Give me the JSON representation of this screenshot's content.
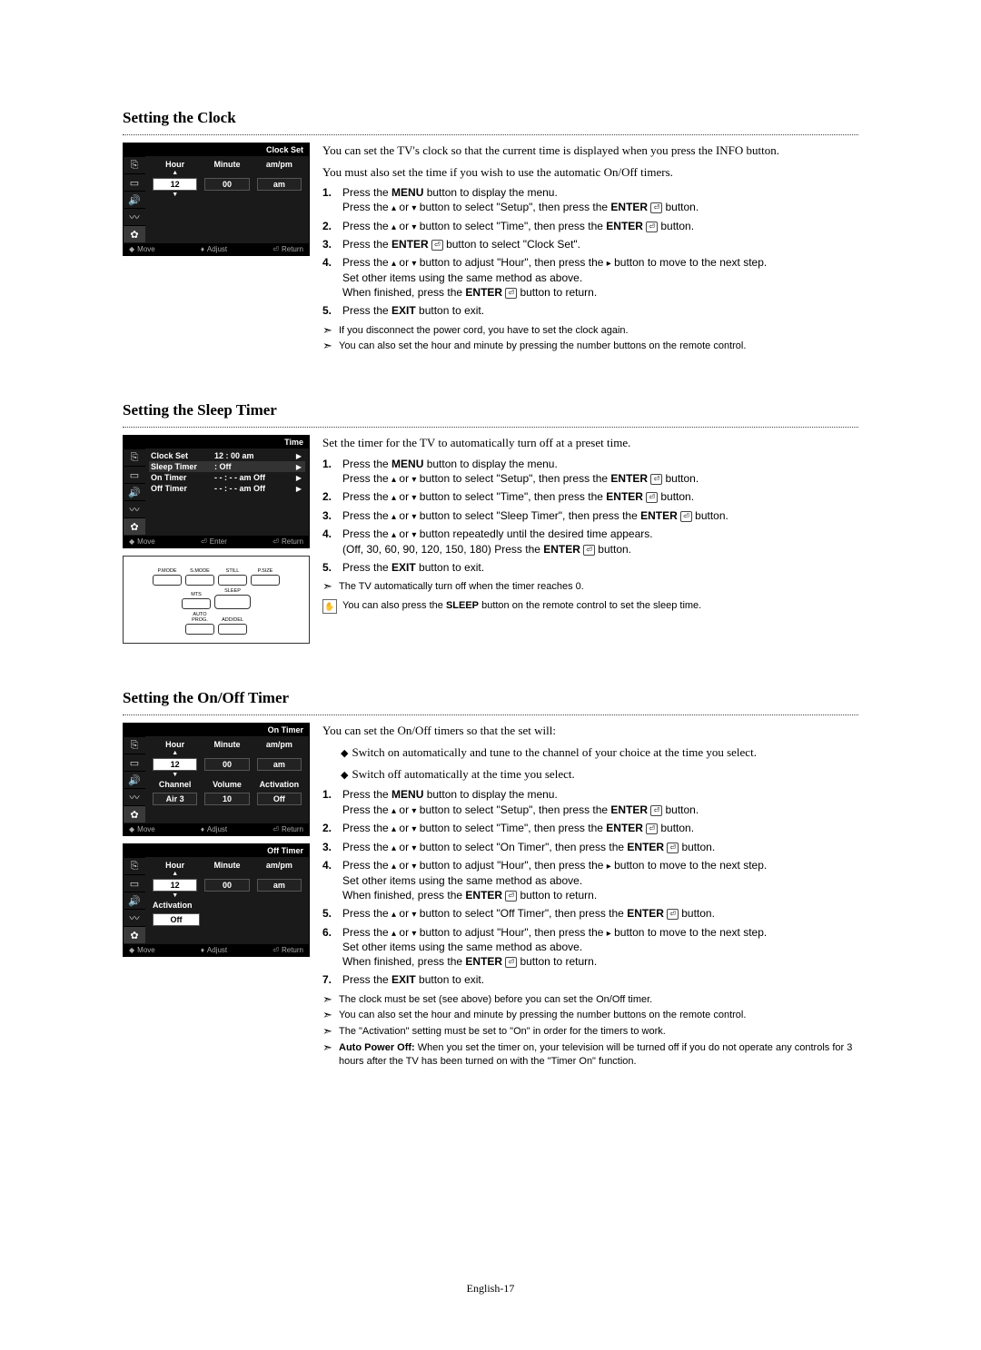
{
  "page_number": "English-17",
  "sections": {
    "clock": {
      "title": "Setting the Clock",
      "intro1": "You can set the TV's clock so that the current time is displayed when you press the INFO button.",
      "intro2": "You must also set the time if you wish to use the automatic On/Off timers.",
      "steps": {
        "s1a": "Press the ",
        "s1b": " button to display the menu.",
        "s1c": "Press the ",
        "s1d": " or ",
        "s1e": " button to select \"Setup\", then press the ",
        "s1f": " button.",
        "s2a": "Press the ",
        "s2b": " or ",
        "s2c": " button to select \"Time\", then press the ",
        "s2d": " button.",
        "s3a": "Press the ",
        "s3b": " button to select \"Clock Set\".",
        "s4a": "Press the ",
        "s4b": " or ",
        "s4c": " button to adjust \"Hour\", then press the ",
        "s4d": " button to move to the next step.",
        "s4e": "Set other items using the same method as above.",
        "s4f": "When finished, press the ",
        "s4g": " button to return.",
        "s5a": "Press the ",
        "s5b": " button to exit."
      },
      "notes": {
        "n1": "If you disconnect the power cord, you have to set the clock again.",
        "n2": "You can also set the hour and minute by pressing the number buttons on the remote control."
      },
      "osd": {
        "title": "Clock  Set",
        "hour_h": "Hour",
        "minute_h": "Minute",
        "ampm_h": "am/pm",
        "hour_v": "12",
        "minute_v": "00",
        "ampm_v": "am",
        "move": "Move",
        "adjust": "Adjust",
        "ret": "Return"
      }
    },
    "sleep": {
      "title": "Setting the Sleep Timer",
      "intro": "Set the timer for the TV to automatically turn off at a preset time.",
      "steps": {
        "s1a": "Press the ",
        "s1b": " button to display the menu.",
        "s1c": "Press the ",
        "s1d": " or ",
        "s1e": " button to select \"Setup\", then press the ",
        "s1f": " button.",
        "s2a": "Press the ",
        "s2b": " or ",
        "s2c": " button to select \"Time\", then press the ",
        "s2d": " button.",
        "s3a": "Press the ",
        "s3b": " or ",
        "s3c": " button to select \"Sleep Timer\", then press the ",
        "s3d": " button.",
        "s4a": "Press the ",
        "s4b": " or ",
        "s4c": " button repeatedly until the desired time appears.",
        "s4d": "(Off, 30, 60, 90, 120, 150, 180) Press the ",
        "s4e": " button.",
        "s5a": "Press the ",
        "s5b": " button to exit."
      },
      "note1": "The TV automatically turn off when the timer reaches 0.",
      "note2a": "You can also press the ",
      "note2b": " button on the remote control to set the sleep time.",
      "osd": {
        "title": "Time",
        "l1": "Clock Set",
        "v1": "12 : 00  am",
        "l2": "Sleep Timer",
        "v2": ": Off",
        "l3": "On Timer",
        "v3": "- - : - - am Off",
        "l4": "Off Timer",
        "v4": "- - : - - am Off",
        "move": "Move",
        "enter": "Enter",
        "ret": "Return"
      },
      "remote": {
        "pmode": "P.MODE",
        "smode": "S.MODE",
        "still": "STILL",
        "psize": "P.SIZE",
        "mts": "MTS",
        "sleep": "SLEEP",
        "autoprog": "AUTO PROG.",
        "adddel": "ADD/DEL"
      }
    },
    "onoff": {
      "title": "Setting the On/Off Timer",
      "intro": "You can set the On/Off timers so that the set will:",
      "bul1": "Switch on automatically and tune to the channel of your choice at the time you select.",
      "bul2": "Switch off automatically at the time you select.",
      "steps": {
        "s1a": "Press the ",
        "s1b": " button to display the menu.",
        "s1c": "Press the ",
        "s1d": " or ",
        "s1e": " button to select \"Setup\", then press the ",
        "s1f": " button.",
        "s2a": "Press the ",
        "s2b": " or ",
        "s2c": " button to select \"Time\", then press the ",
        "s2d": " button.",
        "s3a": "Press the ",
        "s3b": " or ",
        "s3c": " button to select \"On Timer\", then press the ",
        "s3d": " button.",
        "s4a": "Press the ",
        "s4b": " or ",
        "s4c": " button to adjust \"Hour\", then press the ",
        "s4d": " button to move to the next step.",
        "s4e": "Set other items using the same method as above.",
        "s4f": "When finished, press the ",
        "s4g": " button to return.",
        "s5a": "Press the ",
        "s5b": " or ",
        "s5c": " button to select \"Off Timer\", then press the ",
        "s5d": " button.",
        "s6a": "Press the ",
        "s6b": " or ",
        "s6c": " button to adjust \"Hour\", then press the ",
        "s6d": " button to move to the next step.",
        "s6e": "Set other items using the same method as above.",
        "s6f": "When finished, press the ",
        "s6g": " button to return.",
        "s7a": "Press the ",
        "s7b": " button to exit."
      },
      "notes": {
        "n1": "The clock must be set (see above) before you can set the On/Off timer.",
        "n2": "You can also set the hour and minute by pressing the number buttons on the remote control.",
        "n3": "The \"Activation\" setting must be set to \"On\" in order for the timers to work.",
        "n4b": " When you set the timer on, your television will be turned off if you do not operate any controls for 3 hours after the TV has been turned on with the \"Timer On\" function."
      },
      "osd_on": {
        "title": "On Timer",
        "hour_h": "Hour",
        "minute_h": "Minute",
        "ampm_h": "am/pm",
        "hour_v": "12",
        "minute_v": "00",
        "ampm_v": "am",
        "ch_h": "Channel",
        "vol_h": "Volume",
        "act_h": "Activation",
        "ch_v": "Air   3",
        "vol_v": "10",
        "act_v": "Off",
        "move": "Move",
        "adjust": "Adjust",
        "ret": "Return"
      },
      "osd_off": {
        "title": "Off Timer",
        "hour_h": "Hour",
        "minute_h": "Minute",
        "ampm_h": "am/pm",
        "hour_v": "12",
        "minute_v": "00",
        "ampm_v": "am",
        "act_h": "Activation",
        "act_v": "Off",
        "move": "Move",
        "adjust": "Adjust",
        "ret": "Return"
      }
    }
  },
  "labels": {
    "menu": "MENU",
    "enter": "ENTER",
    "exit": "EXIT",
    "sleep": "SLEEP",
    "autopoweroff": "Auto Power Off:"
  }
}
